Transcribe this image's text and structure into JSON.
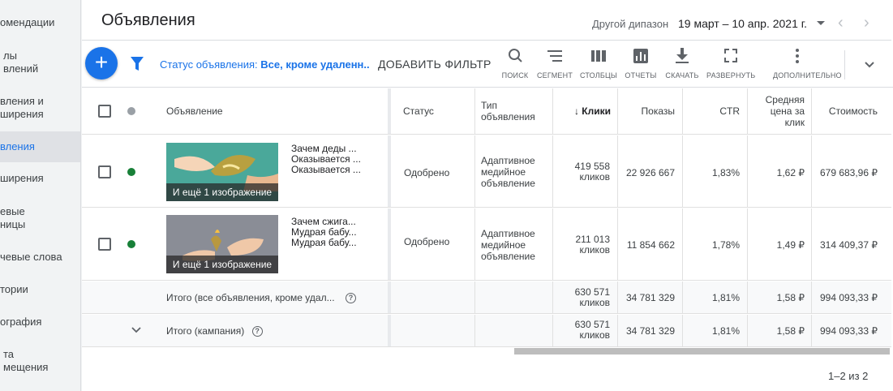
{
  "sidebar": {
    "items": [
      {
        "label": "омендации"
      },
      {
        "label": "лы\nвлений"
      },
      {
        "label": "вления и\nширения"
      },
      {
        "label": "вления"
      },
      {
        "label": "ширения"
      },
      {
        "label": "евые\nницы"
      },
      {
        "label": "чевые слова"
      },
      {
        "label": "тории"
      },
      {
        "label": "ография"
      },
      {
        "label": "та\nмещения"
      }
    ],
    "active_index": 3
  },
  "header": {
    "title": "Объявления",
    "range_label": "Другой дипазон",
    "range_value": "19 март – 10 апр. 2021 г."
  },
  "toolbar": {
    "add_icon": "+",
    "filter_prefix": "Статус объявления: ",
    "filter_value": "Все, кроме удаленн...",
    "add_filter": "ДОБАВИТЬ ФИЛЬТР",
    "tools": [
      {
        "icon": "search-icon",
        "label": "ПОИСК"
      },
      {
        "icon": "segment-icon",
        "label": "СЕГМЕНТ"
      },
      {
        "icon": "columns-icon",
        "label": "СТОЛБЦЫ"
      },
      {
        "icon": "reports-icon",
        "label": "ОТЧЕТЫ"
      },
      {
        "icon": "download-icon",
        "label": "СКАЧАТЬ"
      },
      {
        "icon": "expand-icon",
        "label": "РАЗВЕРНУТЬ"
      },
      {
        "icon": "more-vert-icon",
        "label": "ДОПОЛНИТЕЛЬНО"
      }
    ]
  },
  "table": {
    "headers": {
      "ad": "Объявление",
      "status": "Статус",
      "type": "Тип\nобъявления",
      "clicks": "Клики",
      "impressions": "Показы",
      "ctr": "CTR",
      "avg_cpc": "Средняя\nцена за\nклик",
      "cost": "Стоимость"
    },
    "rows": [
      {
        "lines": [
          "Зачем деды ...",
          "Оказывается ...",
          "Оказывается ..."
        ],
        "image_caption": "И ещё 1 изображение",
        "status": "Одобрено",
        "type": "Адаптивное\nмедийное\nобъявление",
        "clicks": "419 558\nкликов",
        "impressions": "22 926 667",
        "ctr": "1,83%",
        "avg_cpc": "1,62 ₽",
        "cost": "679 683,96 ₽",
        "status_color": "#188038"
      },
      {
        "lines": [
          "Зачем сжига...",
          "Мудрая бабу...",
          "Мудрая бабу..."
        ],
        "image_caption": "И ещё 1 изображение",
        "status": "Одобрено",
        "type": "Адаптивное\nмедийное\nобъявление",
        "clicks": "211 013\nкликов",
        "impressions": "11 854 662",
        "ctr": "1,78%",
        "avg_cpc": "1,49 ₽",
        "cost": "314 409,37 ₽",
        "status_color": "#188038"
      }
    ],
    "totals": [
      {
        "label": "Итого (все объявления, кроме удал...",
        "clicks": "630 571\nкликов",
        "impressions": "34 781 329",
        "ctr": "1,81%",
        "avg_cpc": "1,58 ₽",
        "cost": "994 093,33 ₽"
      },
      {
        "label": "Итого (кампания)",
        "clicks": "630 571\nкликов",
        "impressions": "34 781 329",
        "ctr": "1,81%",
        "avg_cpc": "1,58 ₽",
        "cost": "994 093,33 ₽"
      }
    ]
  },
  "pagination": "1–2 из 2",
  "colors": {
    "accent": "#1a73e8",
    "approved": "#188038"
  }
}
